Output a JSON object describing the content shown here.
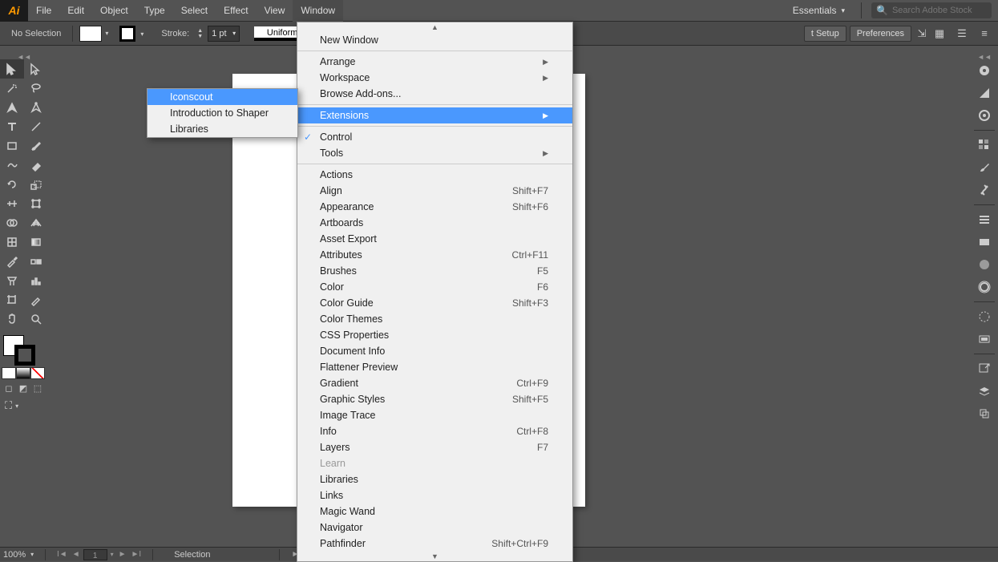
{
  "app": {
    "logo_text": "Ai"
  },
  "menubar": {
    "items": [
      "File",
      "Edit",
      "Object",
      "Type",
      "Select",
      "Effect",
      "View",
      "Window"
    ],
    "active_index": 7,
    "workspace_label": "Essentials",
    "search_placeholder": "Search Adobe Stock"
  },
  "controlbar": {
    "selection_label": "No Selection",
    "stroke_label": "Stroke:",
    "stroke_value": "1 pt",
    "profile_label": "Uniform",
    "setup_btn": "t Setup",
    "prefs_btn": "Preferences"
  },
  "window_menu": {
    "top_block": [
      {
        "label": "New Window",
        "sub": false
      },
      {
        "label": "Arrange",
        "sub": true
      },
      {
        "label": "Workspace",
        "sub": true
      },
      {
        "label": "Browse Add-ons...",
        "sub": false
      }
    ],
    "extensions_label": "Extensions",
    "control_label": "Control",
    "tools_label": "Tools",
    "items": [
      {
        "label": "Actions",
        "shortcut": ""
      },
      {
        "label": "Align",
        "shortcut": "Shift+F7"
      },
      {
        "label": "Appearance",
        "shortcut": "Shift+F6"
      },
      {
        "label": "Artboards",
        "shortcut": ""
      },
      {
        "label": "Asset Export",
        "shortcut": ""
      },
      {
        "label": "Attributes",
        "shortcut": "Ctrl+F11"
      },
      {
        "label": "Brushes",
        "shortcut": "F5"
      },
      {
        "label": "Color",
        "shortcut": "F6"
      },
      {
        "label": "Color Guide",
        "shortcut": "Shift+F3"
      },
      {
        "label": "Color Themes",
        "shortcut": ""
      },
      {
        "label": "CSS Properties",
        "shortcut": ""
      },
      {
        "label": "Document Info",
        "shortcut": ""
      },
      {
        "label": "Flattener Preview",
        "shortcut": ""
      },
      {
        "label": "Gradient",
        "shortcut": "Ctrl+F9"
      },
      {
        "label": "Graphic Styles",
        "shortcut": "Shift+F5"
      },
      {
        "label": "Image Trace",
        "shortcut": ""
      },
      {
        "label": "Info",
        "shortcut": "Ctrl+F8"
      },
      {
        "label": "Layers",
        "shortcut": "F7"
      },
      {
        "label": "Learn",
        "shortcut": "",
        "disabled": true
      },
      {
        "label": "Libraries",
        "shortcut": ""
      },
      {
        "label": "Links",
        "shortcut": ""
      },
      {
        "label": "Magic Wand",
        "shortcut": ""
      },
      {
        "label": "Navigator",
        "shortcut": ""
      },
      {
        "label": "Pathfinder",
        "shortcut": "Shift+Ctrl+F9"
      }
    ]
  },
  "ext_submenu": {
    "items": [
      "Iconscout",
      "Introduction to Shaper",
      "Libraries"
    ],
    "highlight_index": 0
  },
  "statusbar": {
    "zoom": "100%",
    "page": "1",
    "tool": "Selection"
  }
}
